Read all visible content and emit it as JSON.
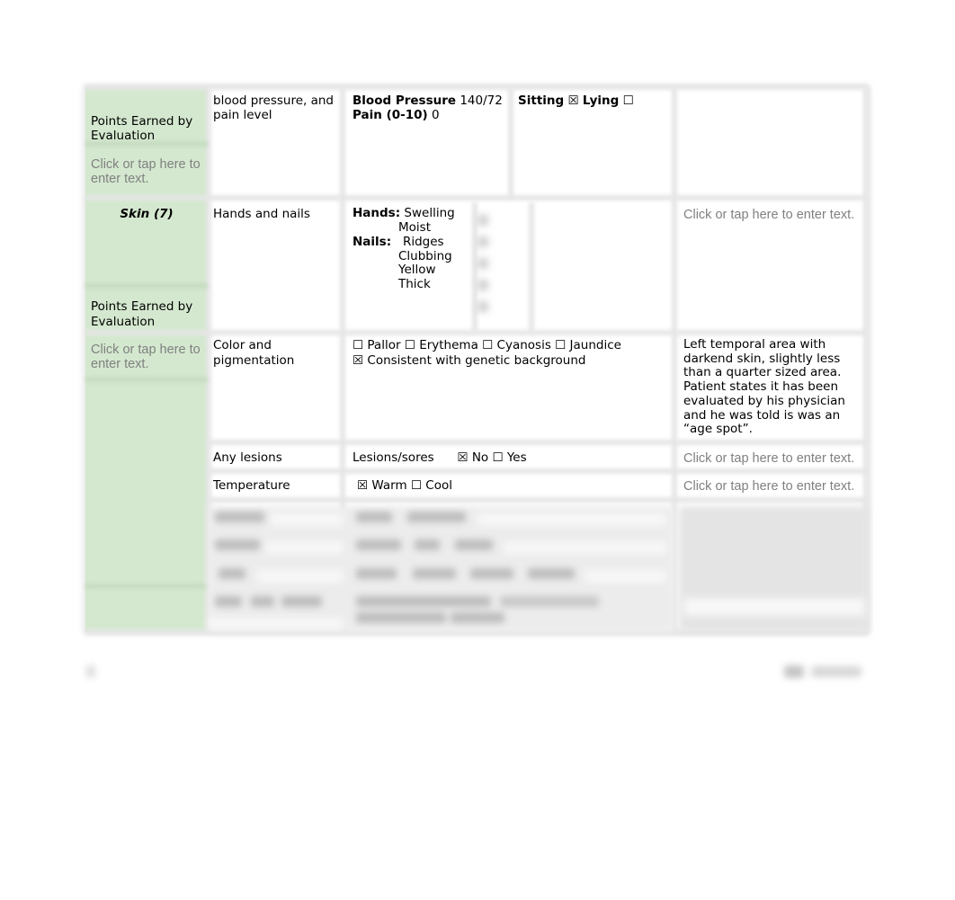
{
  "document": {
    "rows": {
      "vitals": {
        "left_label": "Points Earned by Evaluation",
        "left_placeholder": "Click or tap here to enter text.",
        "criteria": "blood pressure, and pain level",
        "bp_label": "Blood Pressure",
        "bp_value": "140/72",
        "position_sitting_label": "Sitting",
        "position_sitting_checked": "☒",
        "position_lying_label": "Lying",
        "position_lying_checked": "☐",
        "pain_label": "Pain (0-10)",
        "pain_value": "0",
        "comment": ""
      },
      "skin_header": {
        "section_title": "Skin (7)",
        "points_label": "Points Earned by Evaluation",
        "points_placeholder": "Click or tap here to enter text."
      },
      "hands_nails": {
        "criteria": "Hands and nails",
        "hands_label": "Hands:",
        "hands_items": [
          "Swelling",
          "Moist"
        ],
        "nails_label": "Nails:",
        "nails_items": [
          "Ridges",
          "Clubbing",
          "Yellow",
          "Thick"
        ],
        "comment_placeholder": "Click or tap here to enter text."
      },
      "color": {
        "criteria": "Color and pigmentation",
        "options_line1": "☐ Pallor ☐ Erythema ☐ Cyanosis ☐ Jaundice",
        "options_line2": "☒ Consistent with genetic background",
        "comment": "Left temporal area with darkend skin, slightly less than a quarter sized area. Patient states it has been evaluated by his physician and he was told is was an “age spot”."
      },
      "lesions": {
        "criteria": "Any lesions",
        "label": "Lesions/sores",
        "options": "☒ No ☐ Yes",
        "comment_placeholder": "Click or tap here to enter text."
      },
      "temperature": {
        "criteria": "Temperature",
        "options": "☒ Warm ☐ Cool",
        "comment_placeholder": "Click or tap here to enter text."
      }
    }
  }
}
